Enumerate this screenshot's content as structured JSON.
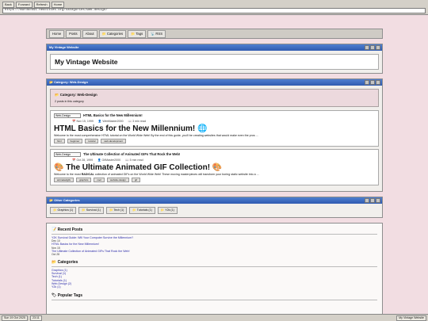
{
  "browser": {
    "buttons": [
      "Back",
      "Forward",
      "Refresh",
      "Home"
    ],
    "url": "https://murdock91.neocities.org/categories/web-design/"
  },
  "menu": [
    {
      "label": "Home",
      "icon": ""
    },
    {
      "label": "Posts",
      "icon": ""
    },
    {
      "label": "About",
      "icon": ""
    },
    {
      "label": "Categories",
      "icon": "folder-icon"
    },
    {
      "label": "Tags",
      "icon": "folder-icon"
    },
    {
      "label": "RSS",
      "icon": "rss-icon"
    }
  ],
  "site_window": {
    "title": "My Vintage Website",
    "heading": "My Vintage Website"
  },
  "category_window": {
    "title": "Category: Web-Design",
    "header": "Category: Web-Design",
    "count": "2 posts in this category",
    "posts": [
      {
        "thumb": "Web-Design",
        "small_title": "HTML Basics for the New Millennium!",
        "date": "Nov 15, 1999",
        "author": "WebMaster2000",
        "read": "3 min read",
        "big_title": "HTML Basics for the New Millennium! 🌐",
        "excerpt": "Welcome to the most comprehensive HTML tutorial on the World Wide Web! By the end of this guide, you'll be creating websites that would make even the pros ...",
        "tags": [
          "html",
          "beginner",
          "tutorial",
          "web-development"
        ]
      },
      {
        "thumb": "Web-Design",
        "small_title": "The Ultimate Collection of Animated GIFs That Rock the Web!",
        "date": "Oct 28, 1999",
        "author": "GifMaster2000",
        "read": "5 min read",
        "big_title": "🎨 The Ultimate Animated GIF Collection! 🎨",
        "excerpt_pre": "Welcome to the most ",
        "excerpt_bold": "RADICAL",
        "excerpt_post": " collection of animated GIFs on the World Wide Web! These moving masterpieces will transform your boring static website into a ...",
        "tags": [
          "animatedgifs",
          "graphics",
          "cool",
          "website-design",
          "gif"
        ]
      }
    ]
  },
  "other_categories": {
    "title": "Other Categories",
    "items": [
      "Graphics (1)",
      "Survival (1)",
      "Tech (1)",
      "Tutorials (1)",
      "Y2k (1)"
    ]
  },
  "sidebar": {
    "recent_header": "Recent Posts",
    "recent": [
      {
        "title": "Y2K Survival Guide: Will Your Computer Survive the Millennium?",
        "date": "Dec 10"
      },
      {
        "title": "HTML Basics for the New Millennium!",
        "date": "Nov 15"
      },
      {
        "title": "The Ultimate Collection of Animated GIFs That Rock the Web!",
        "date": "Oct 28"
      }
    ],
    "categories_header": "Categories",
    "categories": [
      "Graphics (1)",
      "Survival (1)",
      "Tech (1)",
      "Tutorials (1)",
      "Web-Design (2)",
      "Y2k (1)"
    ],
    "tags_header": "Popular Tags"
  },
  "taskbar": {
    "date": "Sun 19 Oct 2025",
    "time": "23:11",
    "app": "My Vintage Website"
  }
}
